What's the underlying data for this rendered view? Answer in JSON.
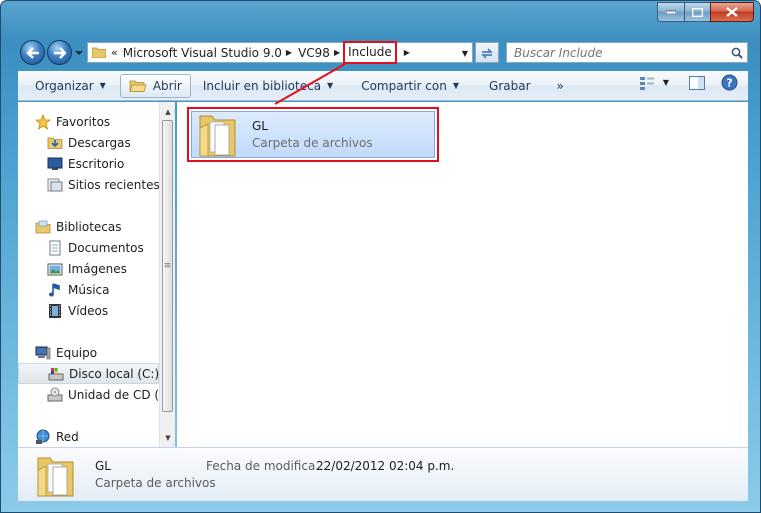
{
  "address_bar": {
    "overflow_chevron": "«",
    "segments": [
      "Microsoft Visual Studio 9.0",
      "VC98",
      "Include"
    ]
  },
  "search": {
    "placeholder": "Buscar Include"
  },
  "toolbar": {
    "organize": "Organizar",
    "open": "Abrir",
    "include_library": "Incluir en biblioteca",
    "share": "Compartir con",
    "burn": "Grabar",
    "more": "»"
  },
  "navigation": {
    "favorites": {
      "label": "Favoritos",
      "items": [
        "Descargas",
        "Escritorio",
        "Sitios recientes"
      ]
    },
    "libraries": {
      "label": "Bibliotecas",
      "items": [
        "Documentos",
        "Imágenes",
        "Música",
        "Vídeos"
      ]
    },
    "computer": {
      "label": "Equipo",
      "items": [
        "Disco local (C:)",
        "Unidad de CD (F:"
      ],
      "selected": "Disco local (C:)"
    },
    "network": {
      "label": "Red"
    }
  },
  "content": {
    "items": [
      {
        "name": "GL",
        "type": "Carpeta de archivos",
        "icon": "folder-icon"
      }
    ]
  },
  "details": {
    "name": "GL",
    "type": "Carpeta de archivos",
    "modified_label": "Fecha de modifica...",
    "modified_value": "22/02/2012 02:04 p.m."
  },
  "colors": {
    "highlight_red": "#e2101f",
    "window_frame": "#4aa1cf",
    "selection": "#c1dbfc"
  }
}
